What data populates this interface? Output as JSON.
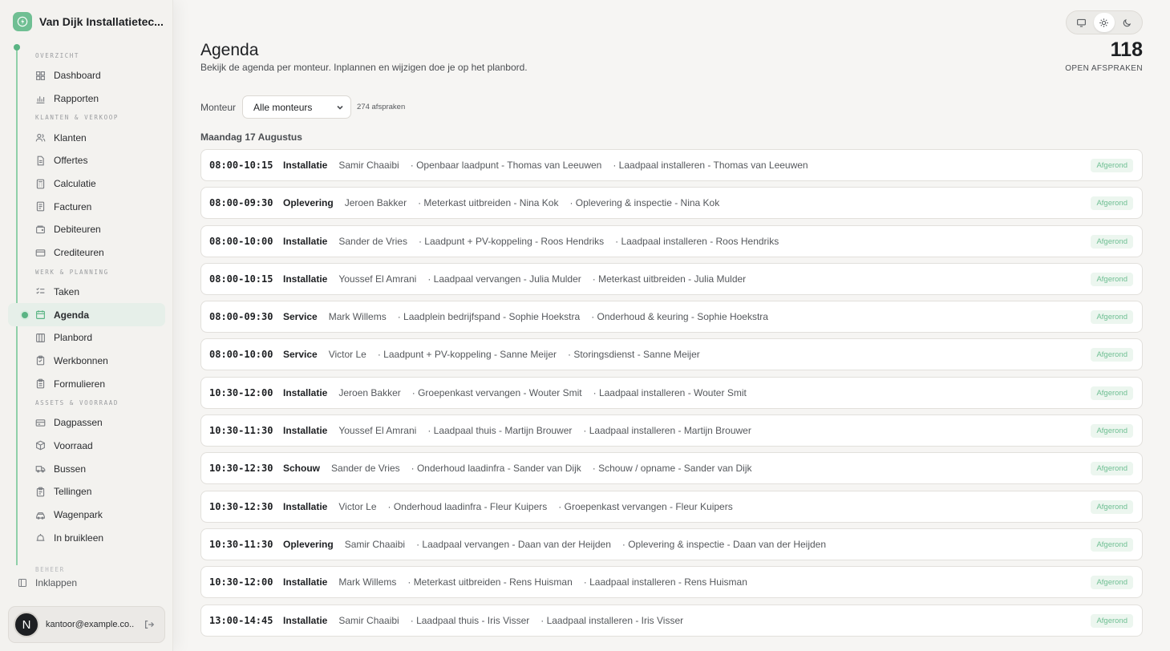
{
  "brand": {
    "name": "Van Dijk Installatietec..."
  },
  "sidebar": {
    "sections": [
      {
        "label": "OVERZICHT",
        "items": [
          {
            "label": "Dashboard",
            "icon": "dashboard-icon"
          },
          {
            "label": "Rapporten",
            "icon": "chart-icon"
          }
        ]
      },
      {
        "label": "KLANTEN & VERKOOP",
        "items": [
          {
            "label": "Klanten",
            "icon": "users-icon"
          },
          {
            "label": "Offertes",
            "icon": "document-icon"
          },
          {
            "label": "Calculatie",
            "icon": "calculator-icon"
          },
          {
            "label": "Facturen",
            "icon": "invoice-icon"
          },
          {
            "label": "Debiteuren",
            "icon": "wallet-icon"
          },
          {
            "label": "Crediteuren",
            "icon": "card-icon"
          }
        ]
      },
      {
        "label": "WERK & PLANNING",
        "items": [
          {
            "label": "Taken",
            "icon": "tasks-icon"
          },
          {
            "label": "Agenda",
            "icon": "calendar-icon",
            "active": true
          },
          {
            "label": "Planbord",
            "icon": "board-icon"
          },
          {
            "label": "Werkbonnen",
            "icon": "clipboard-icon"
          },
          {
            "label": "Formulieren",
            "icon": "form-icon"
          }
        ]
      },
      {
        "label": "ASSETS & VOORRAAD",
        "items": [
          {
            "label": "Dagpassen",
            "icon": "ticket-icon"
          },
          {
            "label": "Voorraad",
            "icon": "box-icon"
          },
          {
            "label": "Bussen",
            "icon": "van-icon"
          },
          {
            "label": "Tellingen",
            "icon": "count-icon"
          },
          {
            "label": "Wagenpark",
            "icon": "car-icon"
          },
          {
            "label": "In bruikleen",
            "icon": "lend-icon"
          }
        ]
      }
    ],
    "beheer_label": "BEHEER",
    "collapse_label": "Inklappen",
    "user": {
      "initial": "N",
      "email": "kantoor@example.co..."
    }
  },
  "header": {
    "title": "Agenda",
    "subtitle": "Bekijk de agenda per monteur. Inplannen en wijzigen doe je op het planbord.",
    "kpi_value": "118",
    "kpi_label": "OPEN AFSPRAKEN"
  },
  "filter": {
    "label": "Monteur",
    "selected": "Alle monteurs",
    "count": "274 afspraken"
  },
  "day": {
    "label": "Maandag 17 Augustus"
  },
  "status_color": "#6fbf93",
  "appointments": [
    {
      "time": "08:00-10:15",
      "type": "Installatie",
      "tech": "Samir Chaaibi",
      "location": "· Openbaar laadpunt - Thomas van Leeuwen",
      "task": "· Laadpaal installeren - Thomas van Leeuwen",
      "status": "Afgerond"
    },
    {
      "time": "08:00-09:30",
      "type": "Oplevering",
      "tech": "Jeroen Bakker",
      "location": "· Meterkast uitbreiden - Nina Kok",
      "task": "· Oplevering & inspectie - Nina Kok",
      "status": "Afgerond"
    },
    {
      "time": "08:00-10:00",
      "type": "Installatie",
      "tech": "Sander de Vries",
      "location": "· Laadpunt + PV-koppeling - Roos Hendriks",
      "task": "· Laadpaal installeren - Roos Hendriks",
      "status": "Afgerond"
    },
    {
      "time": "08:00-10:15",
      "type": "Installatie",
      "tech": "Youssef El Amrani",
      "location": "· Laadpaal vervangen - Julia Mulder",
      "task": "· Meterkast uitbreiden - Julia Mulder",
      "status": "Afgerond"
    },
    {
      "time": "08:00-09:30",
      "type": "Service",
      "tech": "Mark Willems",
      "location": "· Laadplein bedrijfspand - Sophie Hoekstra",
      "task": "· Onderhoud & keuring - Sophie Hoekstra",
      "status": "Afgerond"
    },
    {
      "time": "08:00-10:00",
      "type": "Service",
      "tech": "Victor Le",
      "location": "· Laadpunt + PV-koppeling - Sanne Meijer",
      "task": "· Storingsdienst - Sanne Meijer",
      "status": "Afgerond"
    },
    {
      "time": "10:30-12:00",
      "type": "Installatie",
      "tech": "Jeroen Bakker",
      "location": "· Groepenkast vervangen - Wouter Smit",
      "task": "· Laadpaal installeren - Wouter Smit",
      "status": "Afgerond"
    },
    {
      "time": "10:30-11:30",
      "type": "Installatie",
      "tech": "Youssef El Amrani",
      "location": "· Laadpaal thuis - Martijn Brouwer",
      "task": "· Laadpaal installeren - Martijn Brouwer",
      "status": "Afgerond"
    },
    {
      "time": "10:30-12:30",
      "type": "Schouw",
      "tech": "Sander de Vries",
      "location": "· Onderhoud laadinfra - Sander van Dijk",
      "task": "· Schouw / opname - Sander van Dijk",
      "status": "Afgerond"
    },
    {
      "time": "10:30-12:30",
      "type": "Installatie",
      "tech": "Victor Le",
      "location": "· Onderhoud laadinfra - Fleur Kuipers",
      "task": "· Groepenkast vervangen - Fleur Kuipers",
      "status": "Afgerond"
    },
    {
      "time": "10:30-11:30",
      "type": "Oplevering",
      "tech": "Samir Chaaibi",
      "location": "· Laadpaal vervangen - Daan van der Heijden",
      "task": "· Oplevering & inspectie - Daan van der Heijden",
      "status": "Afgerond"
    },
    {
      "time": "10:30-12:00",
      "type": "Installatie",
      "tech": "Mark Willems",
      "location": "· Meterkast uitbreiden - Rens Huisman",
      "task": "· Laadpaal installeren - Rens Huisman",
      "status": "Afgerond"
    },
    {
      "time": "13:00-14:45",
      "type": "Installatie",
      "tech": "Samir Chaaibi",
      "location": "· Laadpaal thuis - Iris Visser",
      "task": "· Laadpaal installeren - Iris Visser",
      "status": "Afgerond"
    }
  ]
}
